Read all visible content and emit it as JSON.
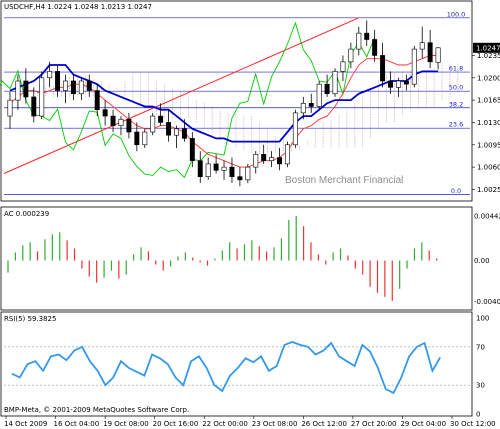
{
  "chart_data": [
    {
      "type": "candlestick",
      "header": "USDCHF,H4  1.0224 1.0248 1.0213 1.0247",
      "watermark": "Boston Merchant Financial",
      "price_axis_ticks": [
        "1.0235",
        "1.0200",
        "1.0165",
        "1.0130",
        "1.0095",
        "1.0060",
        "1.0025"
      ],
      "price_ylim": [
        1.001,
        1.03
      ],
      "current_price": "1.0247",
      "fib_levels": [
        {
          "label": "100.0",
          "price": 1.0294
        },
        {
          "label": "61.8",
          "price": 1.0209
        },
        {
          "label": "50.0",
          "price": 1.0179
        },
        {
          "label": "38.2",
          "price": 1.0153
        },
        {
          "label": "23.6",
          "price": 1.0121
        },
        {
          "label": "0.0",
          "price": 1.0017
        }
      ],
      "candles": [
        {
          "o": 1.014,
          "h": 1.0178,
          "l": 1.012,
          "c": 1.0165
        },
        {
          "o": 1.0165,
          "h": 1.0205,
          "l": 1.015,
          "c": 1.0195
        },
        {
          "o": 1.0195,
          "h": 1.0215,
          "l": 1.016,
          "c": 1.017
        },
        {
          "o": 1.017,
          "h": 1.0185,
          "l": 1.013,
          "c": 1.014
        },
        {
          "o": 1.014,
          "h": 1.021,
          "l": 1.0135,
          "c": 1.02
        },
        {
          "o": 1.02,
          "h": 1.0225,
          "l": 1.0185,
          "c": 1.021
        },
        {
          "o": 1.021,
          "h": 1.022,
          "l": 1.017,
          "c": 1.018
        },
        {
          "o": 1.018,
          "h": 1.0205,
          "l": 1.016,
          "c": 1.0195
        },
        {
          "o": 1.0195,
          "h": 1.0205,
          "l": 1.0165,
          "c": 1.0175
        },
        {
          "o": 1.0175,
          "h": 1.02,
          "l": 1.0165,
          "c": 1.0195
        },
        {
          "o": 1.0195,
          "h": 1.0205,
          "l": 1.017,
          "c": 1.018
        },
        {
          "o": 1.018,
          "h": 1.019,
          "l": 1.014,
          "c": 1.015
        },
        {
          "o": 1.015,
          "h": 1.0165,
          "l": 1.0125,
          "c": 1.014
        },
        {
          "o": 1.014,
          "h": 1.015,
          "l": 1.0115,
          "c": 1.0125
        },
        {
          "o": 1.0125,
          "h": 1.014,
          "l": 1.011,
          "c": 1.0135
        },
        {
          "o": 1.0135,
          "h": 1.0145,
          "l": 1.0105,
          "c": 1.0115
        },
        {
          "o": 1.0115,
          "h": 1.013,
          "l": 1.0085,
          "c": 1.0095
        },
        {
          "o": 1.0095,
          "h": 1.012,
          "l": 1.009,
          "c": 1.0115
        },
        {
          "o": 1.0115,
          "h": 1.0145,
          "l": 1.011,
          "c": 1.014
        },
        {
          "o": 1.014,
          "h": 1.016,
          "l": 1.0125,
          "c": 1.013
        },
        {
          "o": 1.013,
          "h": 1.015,
          "l": 1.01,
          "c": 1.011
        },
        {
          "o": 1.011,
          "h": 1.0125,
          "l": 1.009,
          "c": 1.012
        },
        {
          "o": 1.012,
          "h": 1.0135,
          "l": 1.01,
          "c": 1.0105
        },
        {
          "o": 1.0105,
          "h": 1.0115,
          "l": 1.006,
          "c": 1.007
        },
        {
          "o": 1.007,
          "h": 1.0085,
          "l": 1.0035,
          "c": 1.0045
        },
        {
          "o": 1.0045,
          "h": 1.0075,
          "l": 1.004,
          "c": 1.0065
        },
        {
          "o": 1.0065,
          "h": 1.008,
          "l": 1.005,
          "c": 1.0055
        },
        {
          "o": 1.0055,
          "h": 1.007,
          "l": 1.004,
          "c": 1.006
        },
        {
          "o": 1.006,
          "h": 1.0075,
          "l": 1.0035,
          "c": 1.0045
        },
        {
          "o": 1.0045,
          "h": 1.006,
          "l": 1.003,
          "c": 1.004
        },
        {
          "o": 1.004,
          "h": 1.0065,
          "l": 1.0035,
          "c": 1.006
        },
        {
          "o": 1.006,
          "h": 1.0085,
          "l": 1.005,
          "c": 1.008
        },
        {
          "o": 1.008,
          "h": 1.0095,
          "l": 1.0065,
          "c": 1.007
        },
        {
          "o": 1.007,
          "h": 1.0085,
          "l": 1.006,
          "c": 1.0075
        },
        {
          "o": 1.0075,
          "h": 1.009,
          "l": 1.0055,
          "c": 1.0065
        },
        {
          "o": 1.0065,
          "h": 1.01,
          "l": 1.006,
          "c": 1.0095
        },
        {
          "o": 1.0095,
          "h": 1.015,
          "l": 1.009,
          "c": 1.0145
        },
        {
          "o": 1.0145,
          "h": 1.017,
          "l": 1.0135,
          "c": 1.016
        },
        {
          "o": 1.016,
          "h": 1.0175,
          "l": 1.0145,
          "c": 1.0155
        },
        {
          "o": 1.0155,
          "h": 1.0195,
          "l": 1.015,
          "c": 1.019
        },
        {
          "o": 1.019,
          "h": 1.0205,
          "l": 1.017,
          "c": 1.0175
        },
        {
          "o": 1.0175,
          "h": 1.0215,
          "l": 1.017,
          "c": 1.021
        },
        {
          "o": 1.021,
          "h": 1.0235,
          "l": 1.0195,
          "c": 1.0225
        },
        {
          "o": 1.0225,
          "h": 1.0255,
          "l": 1.0215,
          "c": 1.0245
        },
        {
          "o": 1.0245,
          "h": 1.028,
          "l": 1.0235,
          "c": 1.027
        },
        {
          "o": 1.027,
          "h": 1.029,
          "l": 1.025,
          "c": 1.026
        },
        {
          "o": 1.026,
          "h": 1.0275,
          "l": 1.0225,
          "c": 1.0235
        },
        {
          "o": 1.0235,
          "h": 1.0255,
          "l": 1.0185,
          "c": 1.0195
        },
        {
          "o": 1.0195,
          "h": 1.021,
          "l": 1.0175,
          "c": 1.0185
        },
        {
          "o": 1.0185,
          "h": 1.02,
          "l": 1.017,
          "c": 1.0195
        },
        {
          "o": 1.0195,
          "h": 1.0205,
          "l": 1.018,
          "c": 1.019
        },
        {
          "o": 1.019,
          "h": 1.025,
          "l": 1.0185,
          "c": 1.0245
        },
        {
          "o": 1.0245,
          "h": 1.028,
          "l": 1.023,
          "c": 1.0255
        },
        {
          "o": 1.0255,
          "h": 1.0275,
          "l": 1.0215,
          "c": 1.0225
        },
        {
          "o": 1.0224,
          "h": 1.0248,
          "l": 1.0213,
          "c": 1.0247
        }
      ],
      "ichimoku_tenkan": [
        1.016,
        1.017,
        1.018,
        1.018,
        1.0175,
        1.018,
        1.0185,
        1.0185,
        1.019,
        1.019,
        1.0185,
        1.0175,
        1.0165,
        1.0155,
        1.0145,
        1.0135,
        1.0125,
        1.012,
        1.012,
        1.0125,
        1.0125,
        1.012,
        1.0115,
        1.01,
        1.009,
        1.008,
        1.0075,
        1.007,
        1.0065,
        1.006,
        1.006,
        1.0065,
        1.007,
        1.007,
        1.0075,
        1.0085,
        1.0105,
        1.012,
        1.0125,
        1.0135,
        1.014,
        1.0155,
        1.0175,
        1.02,
        1.022,
        1.023,
        1.023,
        1.023,
        1.0225,
        1.022,
        1.022,
        1.0225,
        1.023,
        1.0235,
        1.0235
      ],
      "ichimoku_kijun": [
        1.018,
        1.0185,
        1.019,
        1.0195,
        1.0205,
        1.022,
        1.022,
        1.022,
        1.0205,
        1.02,
        1.0195,
        1.019,
        1.018,
        1.0175,
        1.017,
        1.0165,
        1.016,
        1.0155,
        1.0155,
        1.015,
        1.015,
        1.014,
        1.013,
        1.012,
        1.0115,
        1.011,
        1.0105,
        1.0105,
        1.01,
        1.01,
        1.01,
        1.01,
        1.01,
        1.01,
        1.01,
        1.0115,
        1.013,
        1.014,
        1.014,
        1.015,
        1.016,
        1.0165,
        1.0165,
        1.0165,
        1.0175,
        1.018,
        1.0185,
        1.019,
        1.0195,
        1.0195,
        1.0195,
        1.0205,
        1.021,
        1.021,
        1.021
      ],
      "trendline": {
        "start": 1.005,
        "end": 1.0294
      },
      "rsi": {
        "label": "RSI(5) 59.3825",
        "ticks": [
          "100",
          "70",
          "30",
          "0"
        ],
        "values": [
          42,
          38,
          52,
          55,
          45,
          60,
          62,
          56,
          66,
          70,
          55,
          45,
          30,
          38,
          55,
          48,
          44,
          40,
          62,
          58,
          52,
          38,
          30,
          55,
          60,
          48,
          30,
          24,
          40,
          48,
          58,
          54,
          60,
          45,
          50,
          72,
          75,
          72,
          70,
          62,
          66,
          74,
          60,
          55,
          50,
          72,
          65,
          48,
          26,
          22,
          38,
          60,
          70,
          74,
          45,
          59
        ]
      },
      "ac": {
        "label": "AC 0.000239",
        "ticks": [
          "0.004423",
          "0.00",
          "-0.00408"
        ],
        "values": [
          -0.0012,
          0.0008,
          0.0015,
          0.0018,
          0.0009,
          0.0021,
          0.0026,
          0.0028,
          0.002,
          0.0012,
          -0.0008,
          -0.0016,
          -0.0022,
          -0.0017,
          -0.001,
          -0.0018,
          -0.0014,
          0.0006,
          0.0013,
          0.0009,
          -0.0004,
          -0.001,
          -0.0006,
          0.0004,
          0.0008,
          0.0003,
          -0.0002,
          -0.0005,
          0.0002,
          0.001,
          0.0018,
          0.0012,
          0.0016,
          0.002,
          0.0014,
          0.0009,
          0.0013,
          0.0022,
          0.004,
          0.0044,
          0.0034,
          0.0018,
          0.0006,
          -0.0004,
          0.0008,
          0.0012,
          0.0005,
          -0.0008,
          -0.0014,
          -0.0026,
          -0.0032,
          -0.0036,
          -0.004,
          -0.0028,
          -0.0008,
          0.0012,
          0.0018,
          0.001,
          0.0002
        ]
      },
      "x_tick_labels": [
        "14 Oct 2009",
        "16 Oct 04:00",
        "19 Oct 08:00",
        "20 Oct 16:00",
        "22 Oct 00:00",
        "23 Oct 08:00",
        "26 Oct 12:00",
        "27 Oct 20:00",
        "29 Oct 04:00",
        "30 Oct 12:00"
      ],
      "copyright": "BMP-Meta, © 2001-2009 MetaQuotes Software Corp."
    }
  ],
  "colors": {
    "bull": "#ffffff",
    "bear": "#000000",
    "tenkan": "#ff3333",
    "kijun": "#0000cc",
    "chikou": "#00cc00",
    "cloud": "#c8a0a8",
    "fib": "#2222cc",
    "trend": "#ff2222",
    "rsi": "#3399ee",
    "ac_up": "#33aa33",
    "ac_down": "#ee3333"
  }
}
